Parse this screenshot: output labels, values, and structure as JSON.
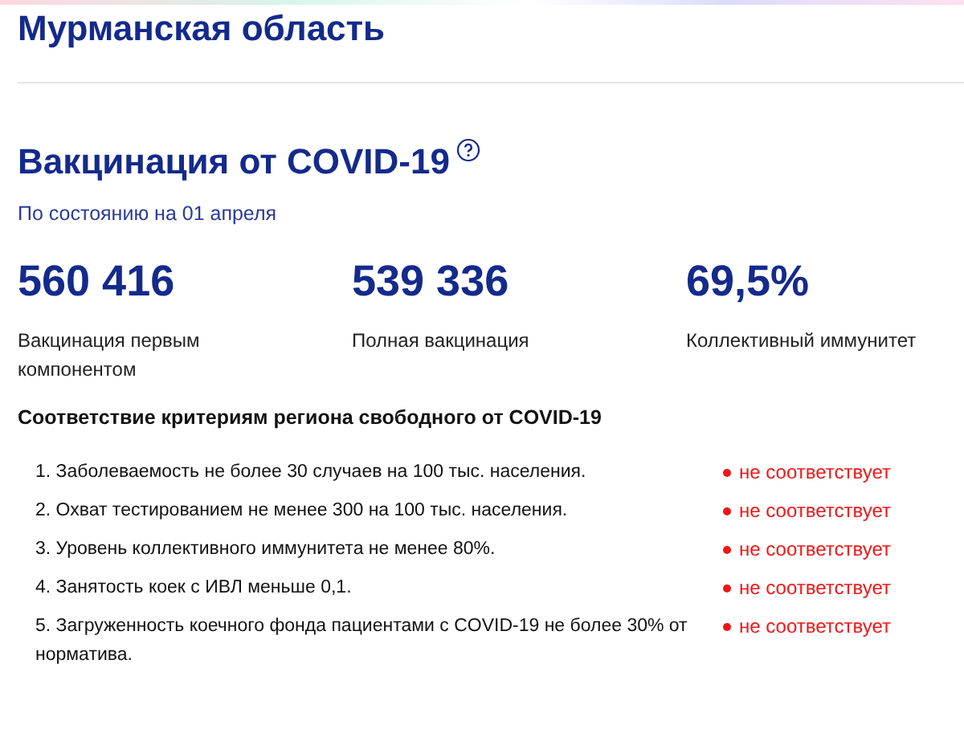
{
  "region": {
    "title": "Мурманская область"
  },
  "vaccination": {
    "title": "Вакцинация от COVID-19",
    "as_of": "По состоянию на 01 апреля",
    "stats": [
      {
        "value": "560 416",
        "label": "Вакцинация первым компонентом"
      },
      {
        "value": "539 336",
        "label": "Полная вакцинация"
      },
      {
        "value": "69,5%",
        "label": "Коллективный иммунитет"
      }
    ]
  },
  "criteria": {
    "title": "Соответствие критериям региона свободного от COVID-19",
    "items": [
      {
        "text": "1. Заболеваемость не более 30 случаев на 100 тыс. населения.",
        "status": "не соответствует",
        "met": false
      },
      {
        "text": "2. Охват тестированием не менее 300 на 100 тыс. населения.",
        "status": "не соответствует",
        "met": false
      },
      {
        "text": "3. Уровень коллективного иммунитета не менее 80%.",
        "status": "не соответствует",
        "met": false
      },
      {
        "text": "4. Занятость коек с ИВЛ меньше 0,1.",
        "status": "не соответствует",
        "met": false
      },
      {
        "text": "5. Загруженность коечного фонда пациентами с COVID-19 не более 30% от норматива.",
        "status": "не соответствует",
        "met": false
      }
    ]
  }
}
